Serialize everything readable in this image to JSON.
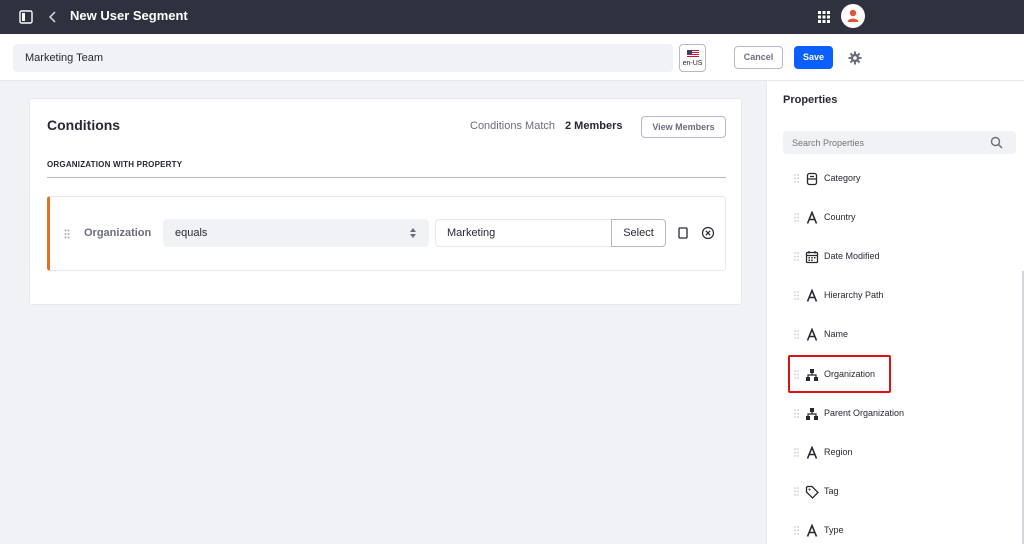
{
  "header": {
    "title": "New User Segment",
    "sidebar_toggle_icon": "sidebar-toggle-icon",
    "back_icon": "chevron-left-icon",
    "apps_icon": "apps-grid-icon",
    "avatar_icon": "user-avatar-icon"
  },
  "toolbar": {
    "segment_name_value": "Marketing Team",
    "language_label": "en-US",
    "language_flag_icon": "us-flag-icon",
    "cancel_label": "Cancel",
    "save_label": "Save",
    "settings_icon": "gear-icon"
  },
  "conditions": {
    "title": "Conditions",
    "match_label": "Conditions Match",
    "members_count": "2 Members",
    "view_members_label": "View Members",
    "section_title": "ORGANIZATION WITH PROPERTY",
    "criterion": {
      "property_label": "Organization",
      "operator_value": "equals",
      "value": "Marketing",
      "select_label": "Select",
      "duplicate_icon": "duplicate-icon",
      "delete_icon": "times-circle-icon"
    }
  },
  "properties": {
    "title": "Properties",
    "search_placeholder": "Search Properties",
    "items": [
      {
        "label": "Category",
        "icon": "categories-icon"
      },
      {
        "label": "Country",
        "icon": "text-icon"
      },
      {
        "label": "Date Modified",
        "icon": "calendar-icon"
      },
      {
        "label": "Hierarchy Path",
        "icon": "text-icon"
      },
      {
        "label": "Name",
        "icon": "text-icon"
      },
      {
        "label": "Organization",
        "icon": "organizations-icon",
        "highlighted": true
      },
      {
        "label": "Parent Organization",
        "icon": "organizations-icon"
      },
      {
        "label": "Region",
        "icon": "text-icon"
      },
      {
        "label": "Tag",
        "icon": "tag-icon"
      },
      {
        "label": "Type",
        "icon": "text-icon"
      }
    ]
  },
  "colors": {
    "header_bg": "#30313f",
    "primary": "#0b5fff",
    "criterion_accent": "#e46f21",
    "highlight_border": "#da1414"
  }
}
